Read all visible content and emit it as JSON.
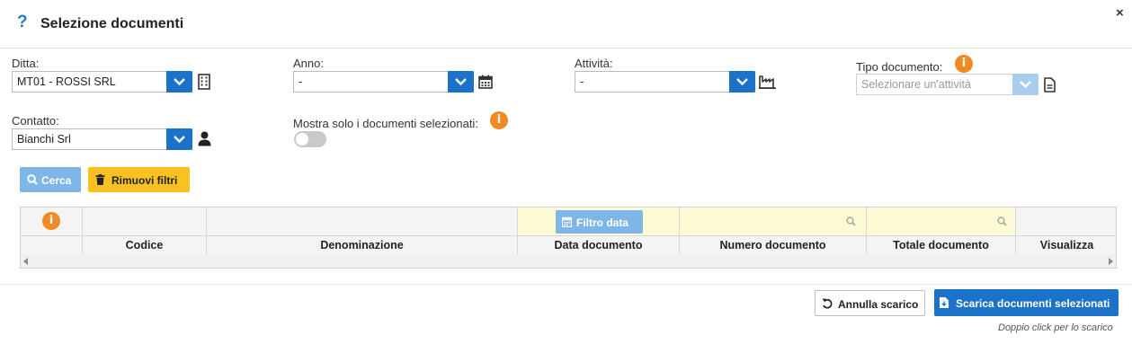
{
  "dialog": {
    "title": "Selezione documenti",
    "help_glyph": "?",
    "close_glyph": "×"
  },
  "filters": {
    "ditta": {
      "label": "Ditta:",
      "value": "MT01 - ROSSI SRL"
    },
    "anno": {
      "label": "Anno:",
      "value": "-"
    },
    "attivita": {
      "label": "Attività:",
      "value": "-"
    },
    "tipo_documento": {
      "label": "Tipo documento:",
      "placeholder": "Selezionare un'attività"
    },
    "contatto": {
      "label": "Contatto:",
      "value": "Bianchi Srl"
    },
    "mostra_solo": {
      "label": "Mostra solo i documenti selezionati:",
      "checked": false
    }
  },
  "actions": {
    "cerca": "Cerca",
    "rimuovi_filtri": "Rimuovi filtri"
  },
  "grid": {
    "filtro_data": "Filtro data",
    "columns": [
      "Codice",
      "Denominazione",
      "Data documento",
      "Numero documento",
      "Totale documento",
      "Visualizza"
    ]
  },
  "footer": {
    "annulla": "Annulla scarico",
    "scarica": "Scarica documenti selezionati",
    "hint": "Doppio click per lo scarico"
  },
  "colors": {
    "primary": "#1a73c9",
    "primary_light": "#7fb6e8",
    "warning": "#f9c221",
    "info": "#f08a24",
    "filter_bg": "#fdfbd5"
  }
}
